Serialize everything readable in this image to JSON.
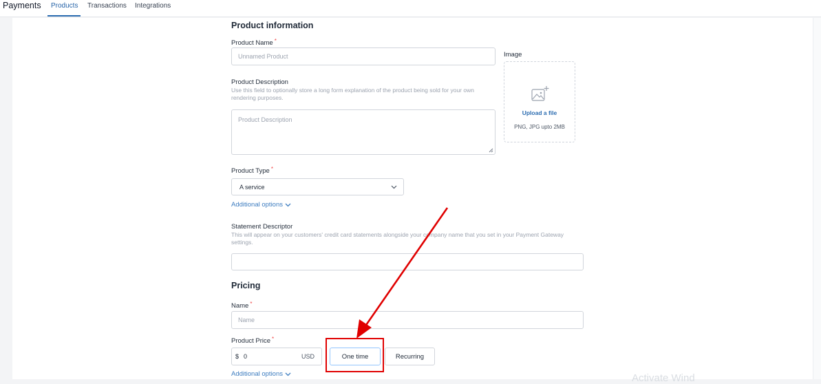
{
  "header": {
    "app_title": "Payments",
    "tabs": [
      {
        "label": "Products",
        "active": true
      },
      {
        "label": "Transactions",
        "active": false
      },
      {
        "label": "Integrations",
        "active": false
      }
    ]
  },
  "product_info": {
    "section_title": "Product information",
    "name_label": "Product Name",
    "name_placeholder": "Unnamed Product",
    "image_label": "Image",
    "upload_link": "Upload a file",
    "upload_hint": "PNG, JPG upto 2MB",
    "description_label": "Product Description",
    "description_help": "Use this field to optionally store a long form explanation of the product being sold for your own rendering purposes.",
    "description_placeholder": "Product Description",
    "type_label": "Product Type",
    "type_value": "A service",
    "additional_options": "Additional options",
    "statement_label": "Statement Descriptor",
    "statement_help": "This will appear on your customers' credit card statements alongside your company name that you set in your Payment Gateway settings.",
    "statement_value": ""
  },
  "pricing": {
    "section_title": "Pricing",
    "name_label": "Name",
    "name_placeholder": "Name",
    "price_label": "Product Price",
    "currency_symbol": "$",
    "price_value": "0",
    "currency": "USD",
    "one_time_label": "One time",
    "recurring_label": "Recurring",
    "additional_options": "Additional options"
  },
  "required_marker": "*",
  "overlay": {
    "watermark_fragment": "Activate Wind"
  },
  "colors": {
    "accent": "#2b6cb0",
    "annotation": "#e00000",
    "required": "#ef4444"
  }
}
